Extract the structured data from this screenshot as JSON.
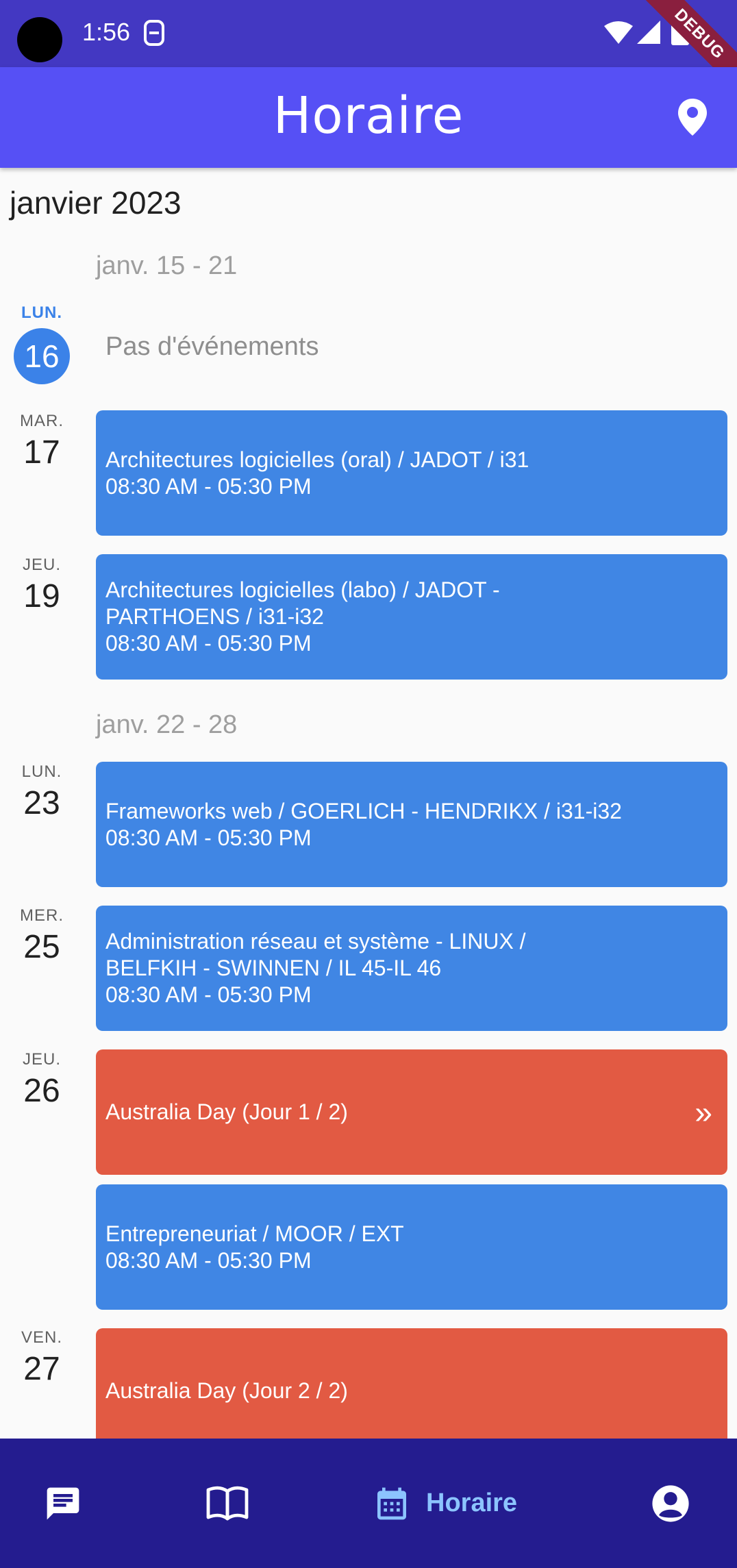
{
  "status_bar": {
    "time": "1:56",
    "debug_banner": "DEBUG"
  },
  "app_bar": {
    "title": "Horaire",
    "action_icon": "location-pin-icon"
  },
  "calendar": {
    "month": "janvier 2023",
    "weeks": [
      {
        "label": "janv. 15 - 21"
      },
      {
        "label": "janv. 22 - 28"
      }
    ],
    "days": [
      {
        "name": "LUN.",
        "num": "16",
        "today": true,
        "no_events": "Pas d'événements"
      },
      {
        "name": "MAR.",
        "num": "17"
      },
      {
        "name": "JEU.",
        "num": "19"
      },
      {
        "name": "LUN.",
        "num": "23"
      },
      {
        "name": "MER.",
        "num": "25"
      },
      {
        "name": "JEU.",
        "num": "26"
      },
      {
        "name": "VEN.",
        "num": "27"
      }
    ],
    "events": [
      {
        "title": "Architectures logicielles (oral) / JADOT / i31",
        "time": "08:30 AM - 05:30 PM",
        "color": "#4086E4"
      },
      {
        "title": "Architectures logicielles (labo) / JADOT - PARTHOENS / i31-i32",
        "time": "08:30 AM - 05:30 PM",
        "color": "#4086E4"
      },
      {
        "title": "Frameworks web / GOERLICH - HENDRIKX / i31-i32",
        "time": "08:30 AM - 05:30 PM",
        "color": "#4086E4"
      },
      {
        "title": "Administration réseau et système - LINUX / BELFKIH - SWINNEN / IL 45-IL 46",
        "time": "08:30 AM - 05:30 PM",
        "color": "#4086E4"
      },
      {
        "title": "Australia Day (Jour 1 / 2)",
        "chevron": "»",
        "color": "#E25A43"
      },
      {
        "title": "Entrepreneuriat / MOOR / EXT",
        "time": "08:30 AM - 05:30 PM",
        "color": "#4086E4"
      },
      {
        "title": "Australia Day (Jour 2 / 2)",
        "color": "#E25A43"
      }
    ]
  },
  "bottom_nav": {
    "items": [
      {
        "icon": "chat-icon"
      },
      {
        "icon": "book-icon"
      },
      {
        "icon": "calendar-icon",
        "label": "Horaire",
        "active": true
      },
      {
        "icon": "account-icon"
      }
    ]
  },
  "colors": {
    "status_bar": "#4338C2",
    "app_bar": "#5650F5",
    "event_blue": "#4086E4",
    "event_red": "#E25A43",
    "nav_bg": "#241C8F",
    "nav_active": "#8CC4FF"
  }
}
